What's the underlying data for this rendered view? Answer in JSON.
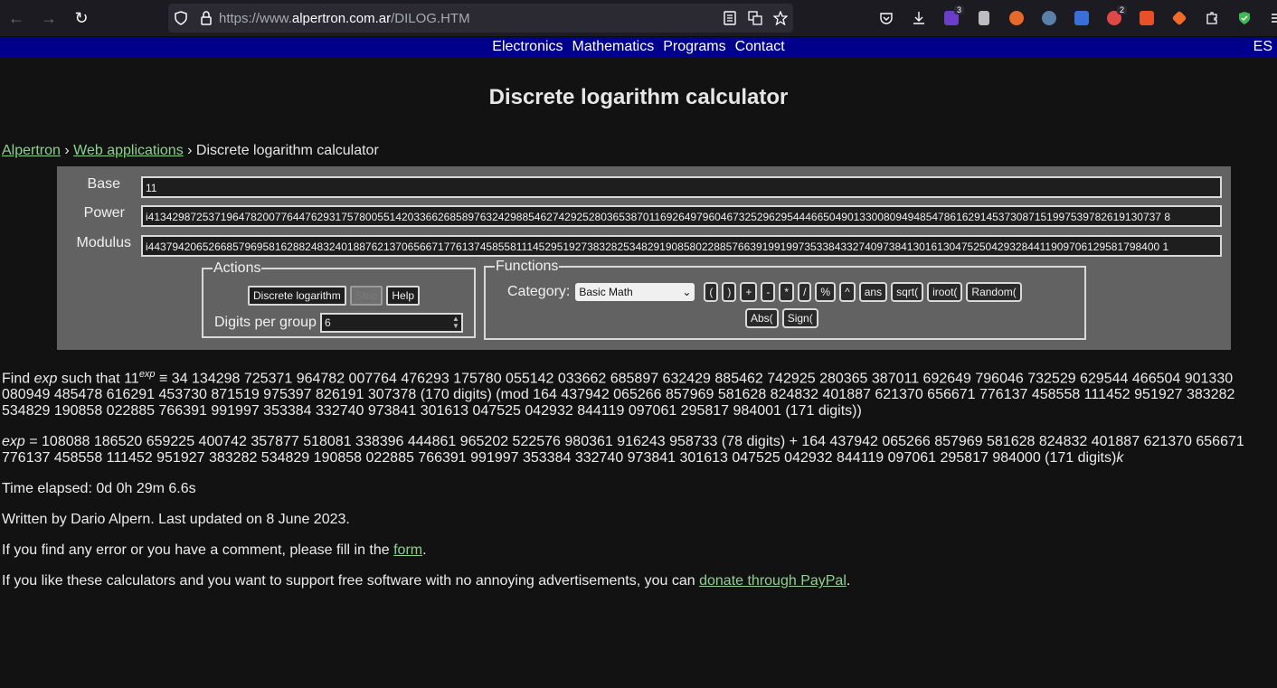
{
  "browser": {
    "url_prefix": "https://www.",
    "url_domain": "alpertron.com.ar",
    "url_path": "/DILOG.HTM",
    "ext_badges": [
      "3",
      "2"
    ]
  },
  "sitenav": {
    "items": [
      "Electronics",
      "Mathematics",
      "Programs",
      "Contact"
    ],
    "lang": "ES"
  },
  "page_title": "Discrete logarithm calculator",
  "breadcrumb": {
    "home": "Alpertron",
    "sep1": " › ",
    "apps": "Web applications",
    "sep2": " › ",
    "current": "Discrete logarithm calculator"
  },
  "calculator": {
    "base_label": "Base",
    "base_value": "11",
    "power_label": "Power",
    "power_value": "i413429872537196478200776447629317578005514203366268589763242988546274292528036538701169264979604673252962954446650490133008094948547861629145373087151997539782619130737 8",
    "modulus_label": "Modulus",
    "modulus_value": "i443794206526685796958162882483240188762137065667177613745855811145295192738328253482919085802288576639199199735338433274097384130161304752504293284411909706129581798400 1",
    "actions_legend": "Actions",
    "btn_discrete_log": "Discrete logarithm",
    "btn_stop": "Stop",
    "btn_help": "Help",
    "digits_label": "Digits per group",
    "digits_value": "6",
    "functions_legend": "Functions",
    "category_label": "Category:",
    "category_value": "Basic Math",
    "fn_buttons_row1": [
      "(",
      ")",
      "+",
      "-",
      "*",
      "/",
      "%",
      "^",
      "ans",
      "sqrt(",
      "iroot(",
      "Random("
    ],
    "fn_buttons_row2": [
      "Abs(",
      "Sign("
    ]
  },
  "results": {
    "find_prefix": "Find ",
    "find_exp": "exp",
    "find_mid": " such that 11",
    "find_sup": "exp",
    "find_body": " ≡ 34 134298 725371 964782 007764 476293 175780 055142 033662 685897 632429 885462 742925 280365 387011 692649 796046 732529 629544 466504 901330 080949 485478 616291 453730 871519 975397 826191 307378 (170 digits) (mod 164 437942 065266 857969 581628 824832 401887 621370 656671 776137 458558 111452 951927 383282 534829 190858 022885 766391 991997 353384 332740 973841 301613 047525 042932 844119 097061 295817 984001 (171 digits))",
    "exp_label": "exp",
    "exp_body": " = 108088 186520 659225 400742 357877 518081 338396 444861 965202 522576 980361 916243 958733 (78 digits) + 164 437942 065266 857969 581628 824832 401887 621370 656671 776137 458558 111452 951927 383282 534829 190858 022885 766391 991997 353384 332740 973841 301613 047525 042932 844119 097061 295817 984000 (171 digits)",
    "exp_k": "k",
    "time": "Time elapsed: 0d 0h 29m 6.6s",
    "written": "Written by Dario Alpern. Last updated on 8 June 2023.",
    "error_text": "If you find any error or you have a comment, please fill in the ",
    "error_link": "form",
    "error_end": ".",
    "donate_text": "If you like these calculators and you want to support free software with no annoying advertisements, you can ",
    "donate_link": "donate through PayPal",
    "donate_end": "."
  }
}
